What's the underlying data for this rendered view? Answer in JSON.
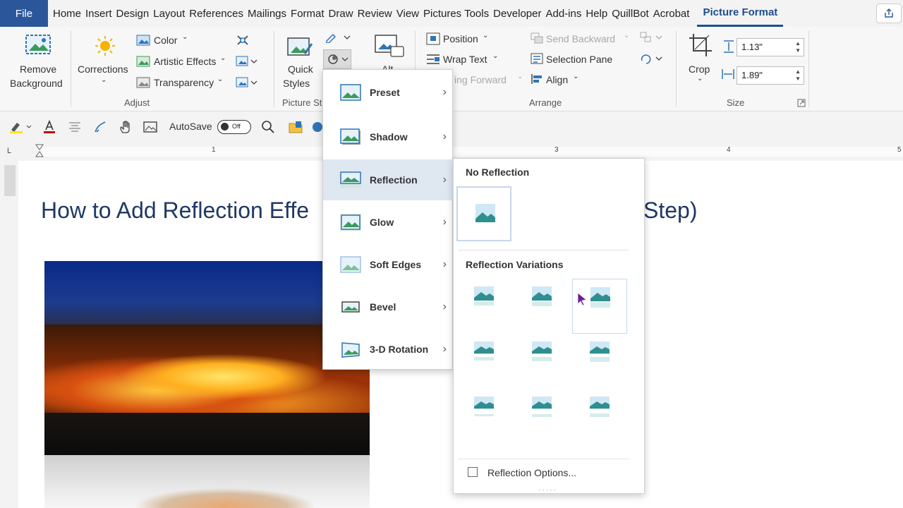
{
  "tabs": {
    "file": "File",
    "items": [
      "Home",
      "Insert",
      "Design",
      "Layout",
      "References",
      "Mailings",
      "Format",
      "Draw",
      "Review",
      "View",
      "Pictures Tools",
      "Developer",
      "Add-ins",
      "Help",
      "QuillBot",
      "Acrobat"
    ],
    "active": "Picture Format"
  },
  "ribbon": {
    "remove_background": [
      "Remove",
      "Background"
    ],
    "corrections": "Corrections",
    "color": "Color",
    "artistic_effects": "Artistic Effects",
    "transparency": "Transparency",
    "adjust_label": "Adjust",
    "quick_styles": [
      "Quick",
      "Styles"
    ],
    "picture_styles_label": "Picture St",
    "alt": "Alt",
    "position": "Position",
    "wrap_text": "Wrap Text",
    "bring_forward": "ing Forward",
    "send_backward": "Send Backward",
    "selection_pane": "Selection Pane",
    "align": "Align",
    "arrange_label": "Arrange",
    "crop": "Crop",
    "height": "1.13\"",
    "width": "1.89\"",
    "size_label": "Size"
  },
  "qat": {
    "autosave": "AutoSave",
    "toggle": "Off"
  },
  "ruler": {
    "marks": [
      "1",
      "3",
      "4",
      "5"
    ]
  },
  "document": {
    "title_left": "How to Add Reflection Effe",
    "title_right": "Step)"
  },
  "effects_menu": {
    "items": [
      "Preset",
      "Shadow",
      "Reflection",
      "Glow",
      "Soft Edges",
      "Bevel",
      "3-D Rotation"
    ],
    "highlighted": "Reflection"
  },
  "reflection_submenu": {
    "no_reflection": "No Reflection",
    "variations": "Reflection Variations",
    "options": "Reflection Options..."
  },
  "colors": {
    "accent": "#2b579a",
    "title": "#1f3864",
    "highlight": "#dfe7f1"
  }
}
